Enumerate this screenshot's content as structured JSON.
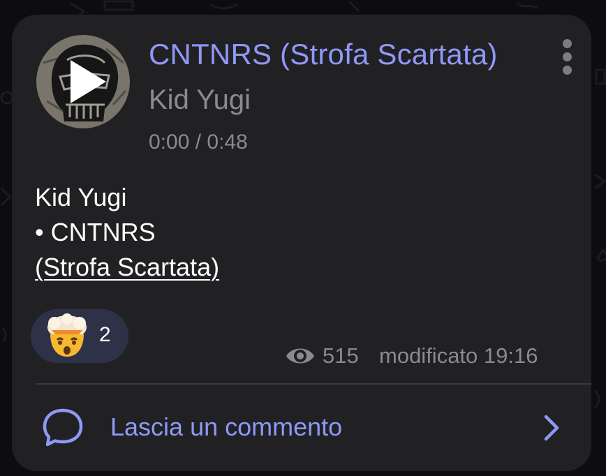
{
  "post": {
    "track_title": "CNTNRS (Strofa Scartata)",
    "track_artist": "Kid Yugi",
    "playback_time": "0:00 / 0:48"
  },
  "caption": {
    "line1": "Kid Yugi",
    "line2": "• CNTNRS",
    "line3": "(Strofa Scartata)"
  },
  "reaction": {
    "emoji": "exploding-head",
    "count": "2"
  },
  "meta": {
    "views": "515",
    "edited": "modificato 19:16"
  },
  "comments": {
    "label": "Lascia un commento"
  },
  "colors": {
    "accent": "#8f98f6",
    "card": "#212124",
    "secondary_text": "#8a8a90",
    "reaction_bg": "#2e3248"
  }
}
